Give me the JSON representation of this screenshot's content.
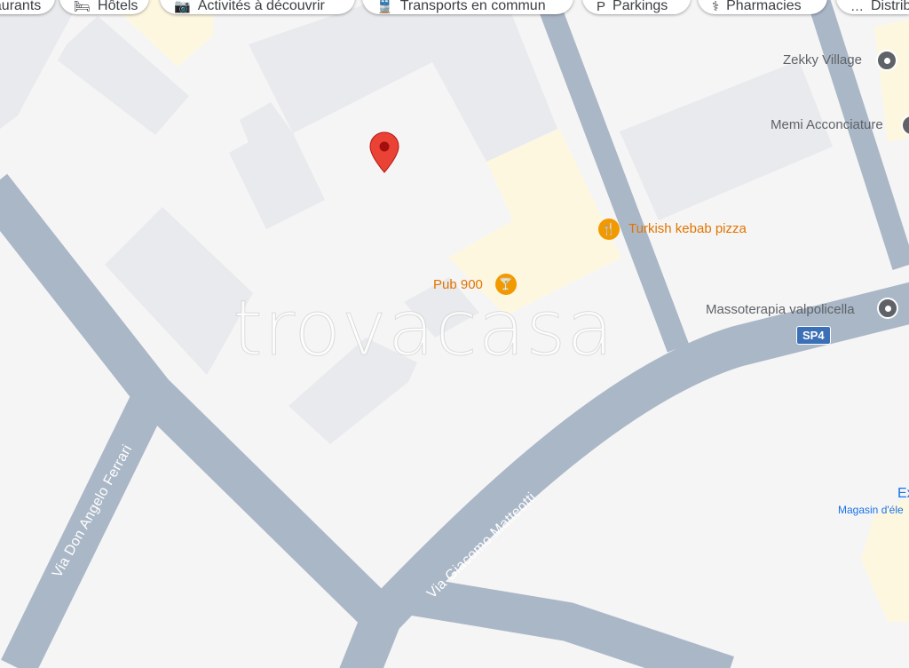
{
  "filter_chips": [
    {
      "label": "Restaurants",
      "icon": "restaurant-icon",
      "glyph": ""
    },
    {
      "label": "Hôtels",
      "icon": "hotel-icon",
      "glyph": "🛏"
    },
    {
      "label": "Activités à découvrir",
      "icon": "camera-icon",
      "glyph": "📷"
    },
    {
      "label": "Transports en commun",
      "icon": "transit-icon",
      "glyph": "🚆"
    },
    {
      "label": "Parkings",
      "icon": "parking-icon",
      "glyph": "P"
    },
    {
      "label": "Pharmacies",
      "icon": "pharmacy-icon",
      "glyph": "⚕"
    },
    {
      "label": "Distributeurs",
      "icon": "atm-icon",
      "glyph": "…"
    }
  ],
  "places": {
    "zekky": "Zekky Village",
    "memi": "Memi Acconciature",
    "turkish": "Turkish kebab pizza",
    "pub": "Pub 900",
    "massoterapia": "Massoterapia valpolicella",
    "ex": "Ex",
    "magasin": "Magasin d'éle"
  },
  "roads": {
    "ferrari": "Via Don Angelo Ferrari",
    "matteotti": "Via Giacomo Matteotti",
    "sp4": "SP4"
  },
  "watermark": "trovacasa",
  "colors": {
    "background": "#f5f5f5",
    "road": "#aab7c7",
    "building": "#e8eaed",
    "commercial": "#fef7e0",
    "food_poi": "#f29900",
    "pin": "#ea4335",
    "shield": "#3b6fb6"
  }
}
